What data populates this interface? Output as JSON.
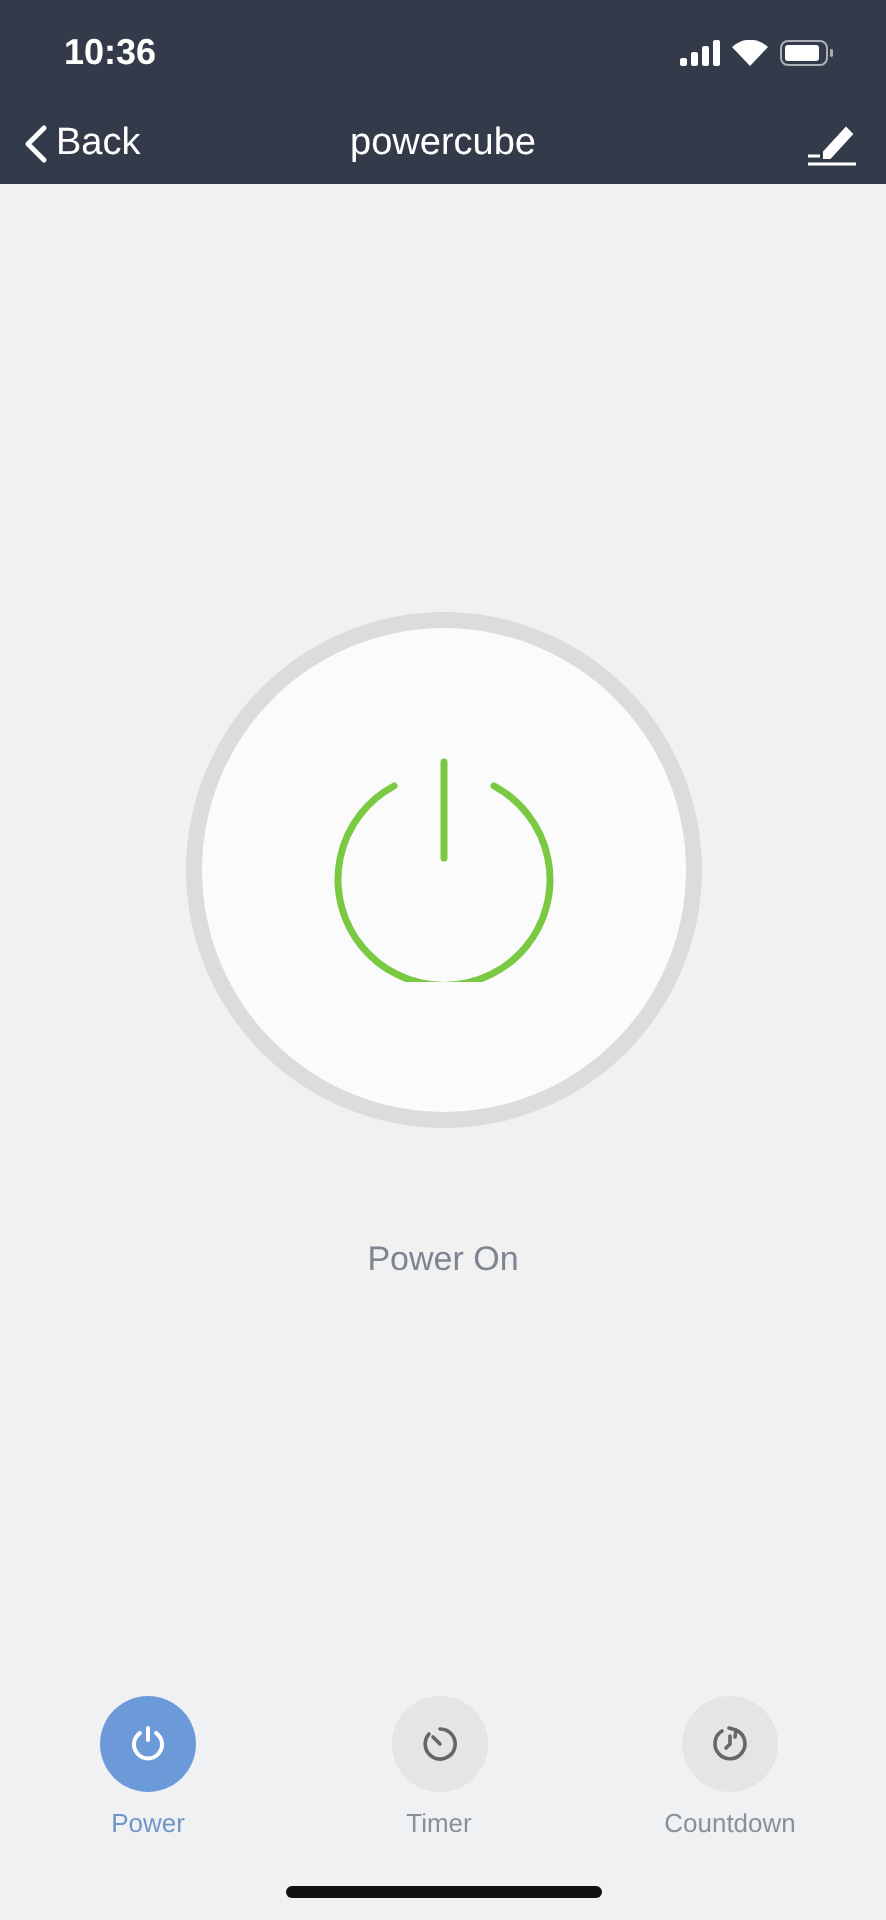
{
  "status_bar": {
    "time": "10:36"
  },
  "nav": {
    "back": "Back",
    "title": "powercube"
  },
  "power": {
    "on": true,
    "status": "Power On"
  },
  "tabs": [
    {
      "kind": "power",
      "label": "Power",
      "selected": true
    },
    {
      "kind": "timer",
      "label": "Timer",
      "selected": false
    },
    {
      "kind": "countdown",
      "label": "Countdown",
      "selected": false
    }
  ]
}
